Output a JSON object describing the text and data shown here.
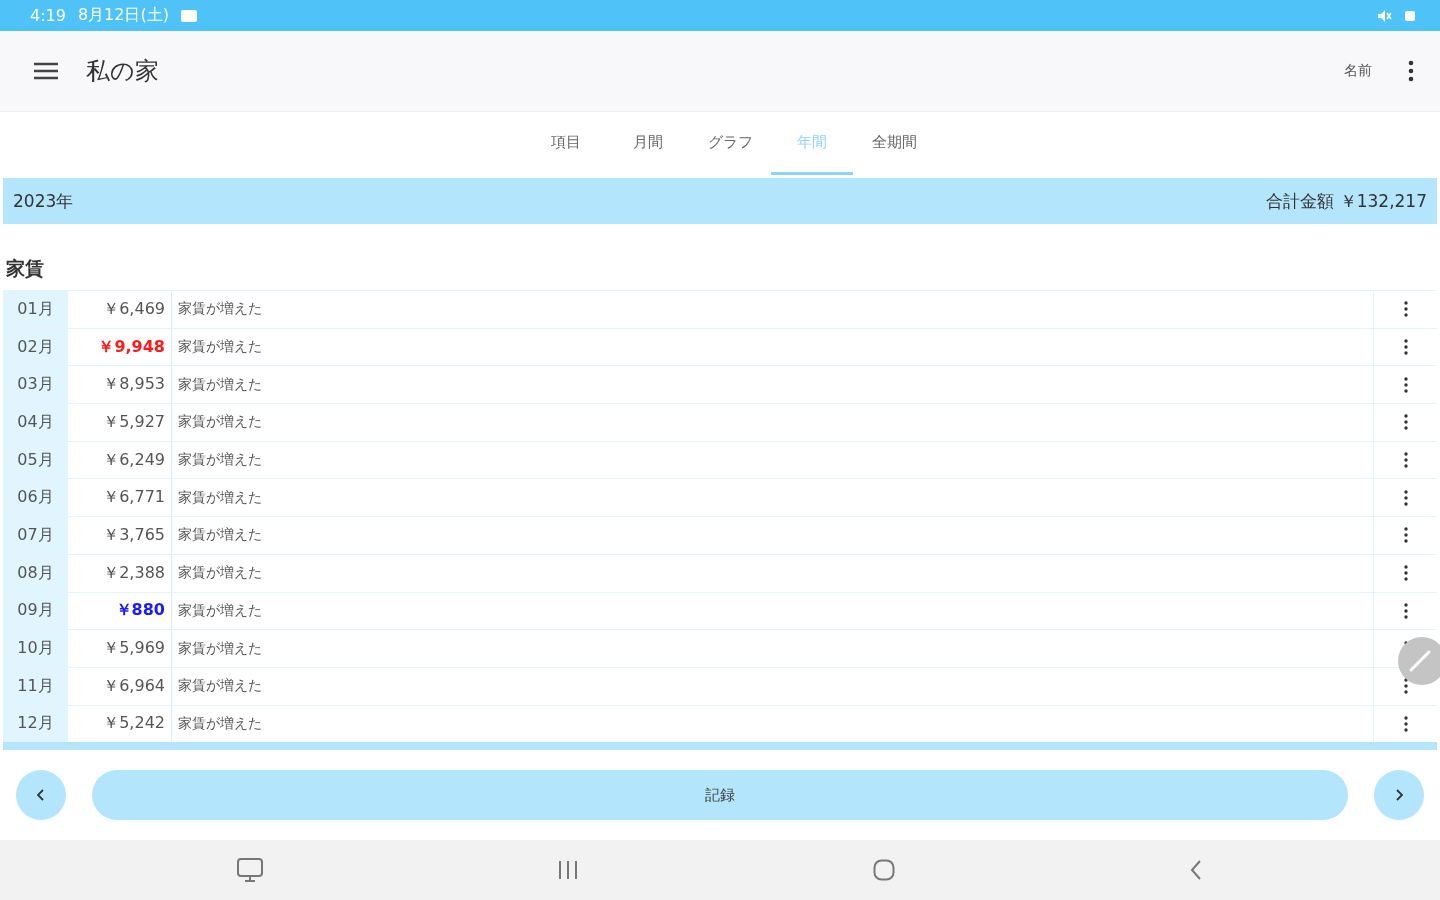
{
  "status_bar": {
    "time": "4:19",
    "date": "8月12日(土)"
  },
  "app_bar": {
    "title": "私の家",
    "action": "名前"
  },
  "tabs": [
    {
      "label": "項目",
      "selected": false
    },
    {
      "label": "月間",
      "selected": false
    },
    {
      "label": "グラフ",
      "selected": false
    },
    {
      "label": "年間",
      "selected": true
    },
    {
      "label": "全期間",
      "selected": false
    }
  ],
  "summary": {
    "year": "2023年",
    "total": "合計金額 ￥132,217"
  },
  "section": {
    "title": "家賃"
  },
  "rows": [
    {
      "month": "01月",
      "amount": "￥6,469",
      "note": "家賃が増えた",
      "kind": "normal"
    },
    {
      "month": "02月",
      "amount": "￥9,948",
      "note": "家賃が増えた",
      "kind": "max"
    },
    {
      "month": "03月",
      "amount": "￥8,953",
      "note": "家賃が増えた",
      "kind": "normal"
    },
    {
      "month": "04月",
      "amount": "￥5,927",
      "note": "家賃が増えた",
      "kind": "normal"
    },
    {
      "month": "05月",
      "amount": "￥6,249",
      "note": "家賃が増えた",
      "kind": "normal"
    },
    {
      "month": "06月",
      "amount": "￥6,771",
      "note": "家賃が増えた",
      "kind": "normal"
    },
    {
      "month": "07月",
      "amount": "￥3,765",
      "note": "家賃が増えた",
      "kind": "normal"
    },
    {
      "month": "08月",
      "amount": "￥2,388",
      "note": "家賃が増えた",
      "kind": "normal"
    },
    {
      "month": "09月",
      "amount": "￥880",
      "note": "家賃が増えた",
      "kind": "min"
    },
    {
      "month": "10月",
      "amount": "￥5,969",
      "note": "家賃が増えた",
      "kind": "normal"
    },
    {
      "month": "11月",
      "amount": "￥6,964",
      "note": "家賃が増えた",
      "kind": "normal"
    },
    {
      "month": "12月",
      "amount": "￥5,242",
      "note": "家賃が増えた",
      "kind": "normal"
    }
  ],
  "footer": {
    "record_button": "記録"
  }
}
